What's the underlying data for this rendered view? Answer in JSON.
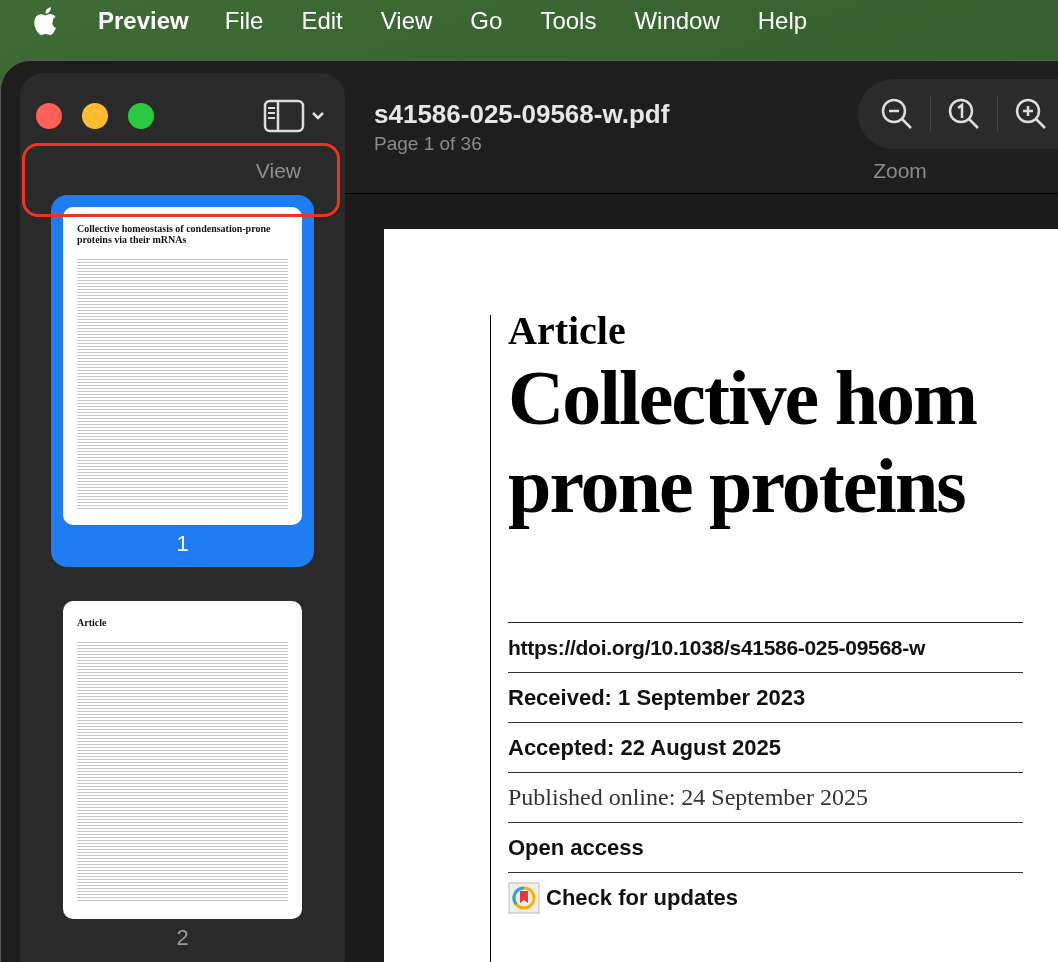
{
  "menu_bar": {
    "app_name": "Preview",
    "items": [
      "File",
      "Edit",
      "View",
      "Go",
      "Tools",
      "Window",
      "Help"
    ]
  },
  "sidebar": {
    "view_label": "View",
    "highlighted": true,
    "thumbnails": [
      {
        "heading": "Collective homeostasis of condensation-prone proteins via their mRNAs",
        "page_number": "1",
        "selected": true
      },
      {
        "heading": "Article",
        "page_number": "2",
        "selected": false
      }
    ]
  },
  "toolbar": {
    "file_name": "s41586-025-09568-w.pdf",
    "page_info": "Page 1 of 36",
    "zoom_label": "Zoom"
  },
  "document": {
    "section": "Article",
    "title_lines": [
      "Collective hom",
      "prone proteins"
    ],
    "info_rows": [
      {
        "kind": "link",
        "text": "https://doi.org/10.1038/s41586-025-09568-w"
      },
      {
        "kind": "bold",
        "text": "Received: 1 September 2023"
      },
      {
        "kind": "bold",
        "text": "Accepted: 22 August 2025"
      },
      {
        "kind": "serif",
        "text": "Published online: 24 September 2025"
      },
      {
        "kind": "bold",
        "text": "Open access"
      },
      {
        "kind": "badge",
        "text": "Check for updates"
      }
    ]
  }
}
